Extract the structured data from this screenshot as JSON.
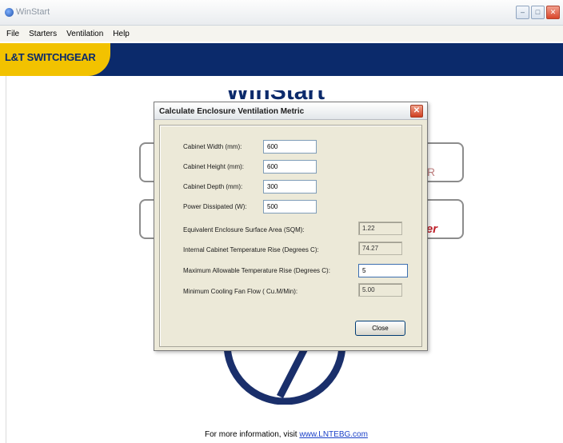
{
  "window": {
    "title": "WinStart",
    "buttons": [
      "minimize",
      "maximize",
      "close"
    ]
  },
  "menu": {
    "items": [
      "File",
      "Starters",
      "Ventilation",
      "Help"
    ]
  },
  "brand": {
    "name": "L&T SWITCHGEAR",
    "tagline": "",
    "bar_color": "#0b2a6b",
    "badge_color": "#f2c200"
  },
  "background": {
    "partial_text_r": "R",
    "partial_text_starter": "rter",
    "footer_prefix": "For more information, visit",
    "footer_link": "www.LNTEBG.com"
  },
  "dialog": {
    "title": "Calculate Enclosure Ventilation Metric",
    "fields": [
      {
        "label": "Cabinet Width (mm):",
        "value": "600"
      },
      {
        "label": "Cabinet Height (mm):",
        "value": "600"
      },
      {
        "label": "Cabinet Depth (mm):",
        "value": "300"
      },
      {
        "label": "Power Dissipated (W):",
        "value": "500"
      }
    ],
    "results": [
      {
        "label": "Equivalent Enclosure Surface Area (SQM):",
        "value": "1.22"
      },
      {
        "label": "Internal Cabinet Temperature Rise (Degrees C):",
        "value": "74.27"
      }
    ],
    "max_rise": {
      "label": "Maximum Allowable Temperature Rise (Degrees C):",
      "value": "5"
    },
    "cooling": {
      "label": "Minimum Cooling Fan Flow ( Cu.M/Min):",
      "value": "5.00"
    },
    "close_label": "Close"
  }
}
